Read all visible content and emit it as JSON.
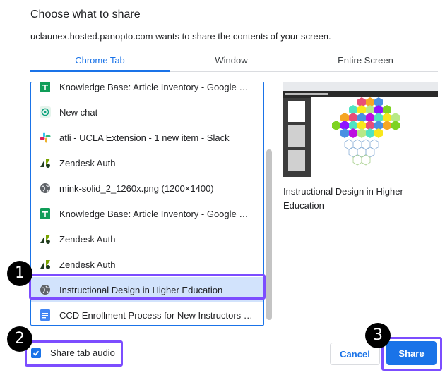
{
  "dialog": {
    "title": "Choose what to share",
    "subtitle": "uclaunex.hosted.panopto.com wants to share the contents of your screen."
  },
  "tabs": [
    {
      "label": "Chrome Tab",
      "active": true
    },
    {
      "label": "Window",
      "active": false
    },
    {
      "label": "Entire Screen",
      "active": false
    }
  ],
  "tab_list": [
    {
      "label": "Knowledge Base: Article Inventory - Google Sh...",
      "icon": "google-sheets-icon"
    },
    {
      "label": "New chat",
      "icon": "chatgpt-icon"
    },
    {
      "label": "atli - UCLA Extension - 1 new item - Slack",
      "icon": "slack-icon"
    },
    {
      "label": "Zendesk Auth",
      "icon": "zendesk-icon"
    },
    {
      "label": "mink-solid_2_1260x.png (1200×1400)",
      "icon": "globe-icon"
    },
    {
      "label": "Knowledge Base: Article Inventory - Google Sh...",
      "icon": "google-sheets-icon"
    },
    {
      "label": "Zendesk Auth",
      "icon": "zendesk-icon"
    },
    {
      "label": "Zendesk Auth",
      "icon": "zendesk-icon"
    },
    {
      "label": "Instructional Design in Higher Education",
      "icon": "globe-icon",
      "selected": true
    },
    {
      "label": "CCD Enrollment Process for New Instructors -...",
      "icon": "google-docs-icon"
    }
  ],
  "preview": {
    "title": "Instructional Design in Higher Education"
  },
  "audio": {
    "label": "Share tab audio",
    "checked": true
  },
  "buttons": {
    "cancel": "Cancel",
    "share": "Share"
  },
  "annotations": [
    "1",
    "2",
    "3"
  ],
  "colors": {
    "accent": "#1a73e8",
    "selected_row": "#d2e3fc",
    "highlight": "#7c4dff"
  }
}
